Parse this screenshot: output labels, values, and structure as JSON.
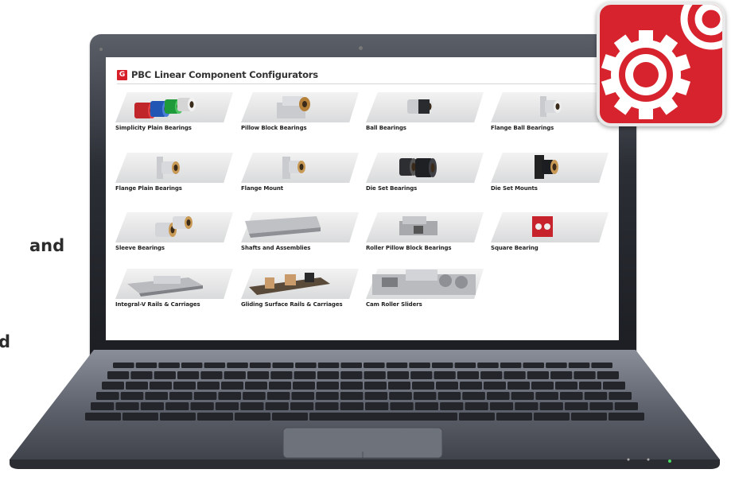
{
  "side_text": [
    "and",
    "d"
  ],
  "configurator": {
    "logo_glyph": "G",
    "title": "PBC Linear Component Configurators",
    "accent": "#d71f2a",
    "products": [
      {
        "label": "Simplicity Plain Bearings",
        "icon": "colored-bearings-icon"
      },
      {
        "label": "Pillow Block Bearings",
        "icon": "pillow-block-icon"
      },
      {
        "label": "Ball Bearings",
        "icon": "ball-bearing-icon"
      },
      {
        "label": "Flange Ball Bearings",
        "icon": "flange-ball-bearing-icon"
      },
      {
        "label": "Flange Plain Bearings",
        "icon": "flange-plain-bearing-icon"
      },
      {
        "label": "Flange Mount",
        "icon": "flange-mount-icon"
      },
      {
        "label": "Die Set Bearings",
        "icon": "die-set-bearing-icon"
      },
      {
        "label": "Die Set Mounts",
        "icon": "die-set-mount-icon"
      },
      {
        "label": "Sleeve Bearings",
        "icon": "sleeve-bearing-icon"
      },
      {
        "label": "Shafts and Assemblies",
        "icon": "shaft-icon"
      },
      {
        "label": "Roller Pillow Block Bearings",
        "icon": "roller-pillow-block-icon"
      },
      {
        "label": "Square Bearing",
        "icon": "square-bearing-icon"
      },
      {
        "label": "Integral-V Rails & Carriages",
        "icon": "integral-v-rail-icon"
      },
      {
        "label": "Gliding Surface Rails & Carriages",
        "icon": "gliding-rail-icon"
      },
      {
        "label": "Cam Roller Sliders",
        "icon": "cam-roller-slider-icon"
      }
    ]
  },
  "app_icon": {
    "name": "configurator-gears-icon",
    "color": "#d7232e"
  }
}
